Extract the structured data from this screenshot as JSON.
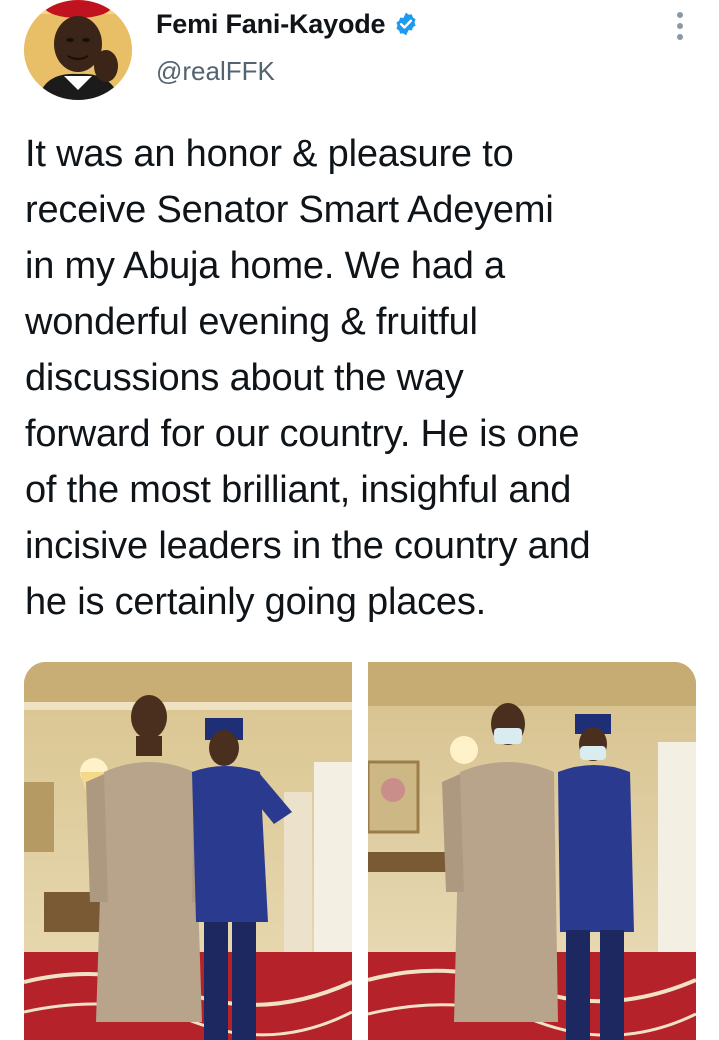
{
  "author": {
    "display_name": "Femi Fani-Kayode",
    "handle": "@realFFK",
    "verified": true,
    "avatar": "profile-photo"
  },
  "tweet": {
    "text": "It was an honor & pleasure to\nreceive Senator Smart Adeyemi\nin my Abuja home. We had a\nwonderful evening & fruitful\ndiscussions about the way\nforward for our country. He is one\nof the most brilliant, insighful and\nincisive leaders in the country and\nhe is certainly going places."
  },
  "media": [
    {
      "kind": "photo",
      "subject": "two men standing in a living room"
    },
    {
      "kind": "photo",
      "subject": "two men wearing face masks in a living room"
    }
  ],
  "icons": {
    "more": "more-vertical-icon",
    "verified": "verified-badge-icon"
  },
  "colors": {
    "verified_blue": "#1d9bf0",
    "text_primary": "#0f1419",
    "text_secondary": "#536471"
  }
}
